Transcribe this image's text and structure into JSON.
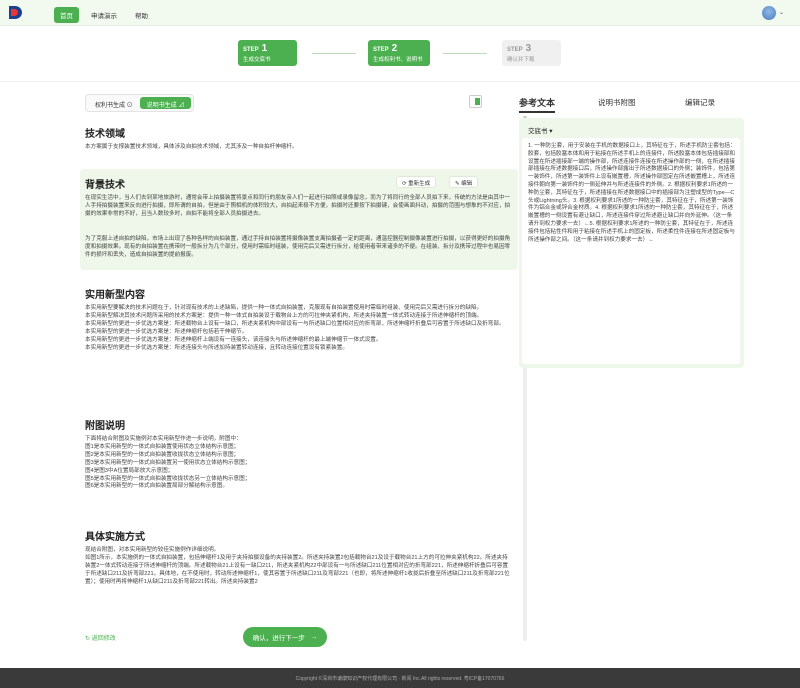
{
  "nav": {
    "items": [
      "首页",
      "申请演示",
      "帮助"
    ]
  },
  "steps": [
    {
      "step": "STEP",
      "num": "1",
      "label": "生成交底书"
    },
    {
      "step": "STEP",
      "num": "2",
      "label": "生成权利书、说明书"
    },
    {
      "step": "STEP",
      "num": "3",
      "label": "确认并下载"
    }
  ],
  "toggle": {
    "a": "权利书生成 ⊙",
    "b": "说明书生成 ⊿"
  },
  "sections": {
    "tech_field": {
      "title": "技术领域",
      "body": "本方案属于支撑装置技术领域，具体涉及自拍技术领域，尤其涉及一种自拍杆伸缩杆。"
    },
    "background": {
      "title": "背景技术",
      "regen": "重新生成",
      "edit": "编辑",
      "body1": "在现实生活中，当人们去到某地旅游时，通常会带上拍摄装置将景点和同行的朋友亲人们一起进行拍照或录像留念，而为了将同行的全部人员拍下来，传统的方法是由其中一人手持拍摄装置来反向进行拍摄，即所谓的自拍，但是由于照相机的体积较大，自拍起来极不方便，拍摄时还要按下拍摄键，会使画面抖动，拍摄的范围与想象的不对应，拍摄的效果非常的不好，且当人数较多时，自拍不能将全部人员拍摄进去。",
      "body2": "为了克服上述自拍的缺陷，市场上出现了各种各样的自拍装置，通过手持自拍装置将摄像装置支离拍摄者一定的距离，通温控器控制摄像装置进行拍摄，以获得更好的拍摄角度和拍摄效果。现有的自拍装置在携带时一般拆分为几个部分，使用时需临时组装，使用完后又需进行拆分，给使用者带来诸多的不便。在组装、拆分及携带过程中也易因零件的损坏和丢失，造成自拍装置的提前报废。"
    },
    "utility": {
      "title": "实用新型内容",
      "lines": [
        "本实用新型要解决的技术问题在于，针对现有技术的上述缺陷，提供一种一体式自拍装置，克服现有自拍装置使用时需临时组装、使用完后又需进行拆分的缺陷。",
        "本实用新型解决其技术问题所采用的技术方案是：提供一种一体式自拍装设于载物台上方的可拉伸夹紧机构，所述夹持装置一体式转动连接于所述伸缩杆的顶端。",
        "本实用新型的更进一步优选方案是：所述载物台上设有一缺口，所述夹紧机构中部设有一与所述缺口位置相对应的折弯部，所述伸缩杆折叠后可容置于所述缺口及折弯部。",
        "本实用新型的更进一步优选方案是：所述伸缩杆包括若干伸缩节。",
        "本实用新型的更进一步优选方案是：所述伸缩杆上端设有一连接头，该连接头与所述伸缩杆的最上端伸缩节一体式设置。",
        "本实用新型的更进一步优选方案是：所述连接头与所述加持装置转动连接，且转动连接位置设有锁紧装置。"
      ]
    },
    "drawings": {
      "title": "附图说明",
      "lines": [
        "下面将结合附图及实施例对本实用新型作进一步说明，附图中：",
        "图1是本实用新型的一体式自拍装置使用状态立体结构示意图；",
        "图2是本实用新型的一体式自拍装置收拢状态立体结构示意图；",
        "图3是本实用新型的一体式自拍装置另一使用状态立体结构示意图；",
        "图4是图3中A位置局部放大示意图；",
        "图5是本实用新型的一体式自拍装置收拢状态另一立体结构示意图；",
        "图6是本实用新型的一体式自拍装置局部分解结构示意图。"
      ]
    },
    "embodiment": {
      "title": "具体实施方式",
      "lines": [
        "现结合附图，对本实用新型的较佳实施例作详细说明。",
        "如图1所示，本实施例的一体式自拍装置，包括伸缩杆1及用于夹持拍摄设备的夹持装置2。所述夹持装置2包括载物台21及设于载物台21上方的可拉伸夹紧机构22。所述夹持装置2一体式转动连接于所述伸缩杆的顶端。所述载物台21上设有一缺口211，所述夹紧机构22中部设有一与所述缺口211位置相对应的折弯部221，所述伸缩杆折叠后可容置于所述缺口211及折弯部221。具体地，在不使用时，转动所述伸缩杆1，使其容置于所述缺口211及弯部221（也即，将所述伸缩杆1收拢后折叠至所述缺口211及折弯部221位置）；使用时再将伸缩杆1从缺口211及折弯部221转出。所述夹持装置2"
      ]
    }
  },
  "actions": {
    "back": "↻ 返回修改",
    "next": "确认，进行下一步"
  },
  "right": {
    "tabs": [
      "参考文本",
      "说明书附图",
      "编辑记录"
    ],
    "select": "交底书 ▾",
    "text": "1. 一种防尘套，用于安装在手机的数据接口上，其特征在于，所述手机防尘套包括：胶套，包括胶塞本体和用于粘接在所述手机上的连接件，所述胶塞本体包括插接部和设置在所述插接部一端的操作部，所述连接件连接在所述操作部的一侧，在所述插接部插接在所述数据接口后，所述操作部露出于所述数据接口的外侧；装饰件，包括第一装饰件，所述第一装饰件上设有嵌置槽，所述操作部固定在所述嵌置槽上，所述连接件朝向第一装饰件的一侧延伸并与所述连接件的外侧。2. 根据权利要求1所述的一种防尘套，其特征在于，所述插接在所述数据接口中的插接部为注塑成型的Type—C头或Lightning头。3. 根据权利要求1所述的一种防尘套，其特征在于，所述第一装饰件为铝合金或锌合金材质。4. 根据权利要求1所述的一种防尘套，其特征在于，所述嵌置槽的一侧设置有避让缺口，所述连接件穿过所述避让缺口并向外延伸。（这一条请升到权力要求一去）←5. 根据权利要求1所述的一种防尘套，其特征在于，所述连接件包括粘性件和用于粘接在所述手机上的固定板，所述柔性件连接在所述固定板与所述操作部之间。（这一条请并到权力要求一去）←"
  },
  "footer": "Copyright ©深圳市谦康知识产权代理有限公司 · 新闻 Inc.All rights reserved.   粤ICP备17070766"
}
